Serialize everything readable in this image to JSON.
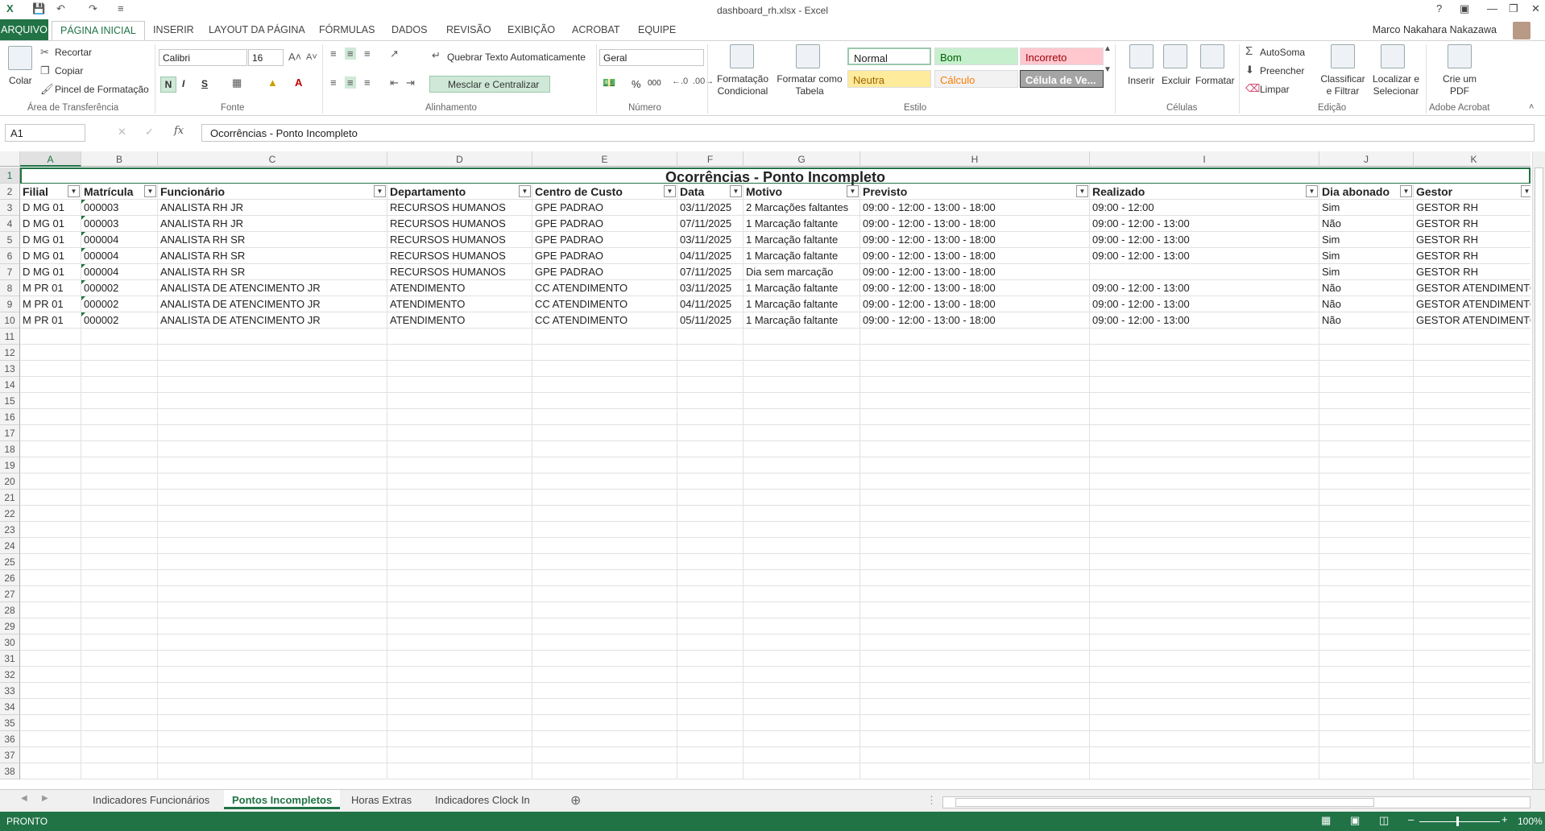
{
  "app": {
    "file_title": "dashboard_rh.xlsx - Excel",
    "user": "Marco Nakahara Nakazawa"
  },
  "tabs": [
    "ARQUIVO",
    "PÁGINA INICIAL",
    "INSERIR",
    "LAYOUT DA PÁGINA",
    "FÓRMULAS",
    "DADOS",
    "REVISÃO",
    "EXIBIÇÃO",
    "ACROBAT",
    "EQUIPE"
  ],
  "ribbon": {
    "clipboard": {
      "paste": "Colar",
      "cut": "Recortar",
      "copy": "Copiar",
      "format_painter": "Pincel de Formatação",
      "group": "Área de Transferência"
    },
    "font": {
      "name": "Calibri",
      "size": "16",
      "bold": "N",
      "italic": "I",
      "underline": "S",
      "group": "Fonte"
    },
    "alignment": {
      "wrap": "Quebrar Texto Automaticamente",
      "merge": "Mesclar e Centralizar",
      "group": "Alinhamento"
    },
    "number": {
      "format": "Geral",
      "percent": "%",
      "thousands": "000",
      "group": "Número"
    },
    "styles": {
      "cond_format": "Formatação Condicional",
      "format_table": "Formatar como Tabela",
      "cells": [
        {
          "label": "Normal",
          "bg": "#ffffff",
          "fg": "#222222"
        },
        {
          "label": "Bom",
          "bg": "#c6efce",
          "fg": "#006100"
        },
        {
          "label": "Incorreto",
          "bg": "#ffc7ce",
          "fg": "#9c0006"
        },
        {
          "label": "Neutra",
          "bg": "#ffeb9c",
          "fg": "#9c6500"
        },
        {
          "label": "Cálculo",
          "bg": "#f2f2f2",
          "fg": "#fa7d00"
        },
        {
          "label": "Célula de Ve...",
          "bg": "#a5a5a5",
          "fg": "#ffffff"
        }
      ],
      "group": "Estilo"
    },
    "cells": {
      "insert": "Inserir",
      "delete": "Excluir",
      "format": "Formatar",
      "group": "Células"
    },
    "editing": {
      "autosum": "AutoSoma",
      "fill": "Preencher",
      "clear": "Limpar",
      "sort": "Classificar e Filtrar",
      "find": "Localizar e Selecionar",
      "group": "Edição"
    },
    "acrobat": {
      "create_pdf": "Crie um PDF",
      "group": "Adobe Acrobat"
    }
  },
  "formula_bar": {
    "name_box": "A1",
    "fx": "fx",
    "content": "Ocorrências - Ponto Incompleto"
  },
  "sheet": {
    "columns": [
      "A",
      "B",
      "C",
      "D",
      "E",
      "F",
      "G",
      "H",
      "I",
      "J",
      "K"
    ],
    "title": "Ocorrências - Ponto Incompleto",
    "headers": [
      "Filial",
      "Matrícula",
      "Funcionário",
      "Departamento",
      "Centro de Custo",
      "Data",
      "Motivo",
      "Previsto",
      "Realizado",
      "Dia abonado",
      "Gestor"
    ],
    "rows": [
      [
        "D MG 01",
        "000003",
        "ANALISTA RH JR",
        "RECURSOS HUMANOS",
        "GPE PADRAO",
        "03/11/2025",
        "2 Marcações faltantes",
        "09:00 - 12:00 - 13:00 - 18:00",
        "09:00 - 12:00",
        "Sim",
        "GESTOR RH"
      ],
      [
        "D MG 01",
        "000003",
        "ANALISTA RH JR",
        "RECURSOS HUMANOS",
        "GPE PADRAO",
        "07/11/2025",
        "1 Marcação faltante",
        "09:00 - 12:00 - 13:00 - 18:00",
        "09:00 - 12:00 - 13:00",
        "Não",
        "GESTOR RH"
      ],
      [
        "D MG 01",
        "000004",
        "ANALISTA RH SR",
        "RECURSOS HUMANOS",
        "GPE PADRAO",
        "03/11/2025",
        "1 Marcação faltante",
        "09:00 - 12:00 - 13:00 - 18:00",
        "09:00 - 12:00 - 13:00",
        "Sim",
        "GESTOR RH"
      ],
      [
        "D MG 01",
        "000004",
        "ANALISTA RH SR",
        "RECURSOS HUMANOS",
        "GPE PADRAO",
        "04/11/2025",
        "1 Marcação faltante",
        "09:00 - 12:00 - 13:00 - 18:00",
        "09:00 - 12:00 - 13:00",
        "Sim",
        "GESTOR RH"
      ],
      [
        "D MG 01",
        "000004",
        "ANALISTA RH SR",
        "RECURSOS HUMANOS",
        "GPE PADRAO",
        "07/11/2025",
        "Dia sem marcação",
        "09:00 - 12:00 - 13:00 - 18:00",
        "",
        "Sim",
        "GESTOR RH"
      ],
      [
        "M PR 01",
        "000002",
        "ANALISTA DE ATENCIMENTO JR",
        "ATENDIMENTO",
        "CC ATENDIMENTO",
        "03/11/2025",
        "1 Marcação faltante",
        "09:00 - 12:00 - 13:00 - 18:00",
        "09:00 - 12:00 - 13:00",
        "Não",
        "GESTOR ATENDIMENTO"
      ],
      [
        "M PR 01",
        "000002",
        "ANALISTA DE ATENCIMENTO JR",
        "ATENDIMENTO",
        "CC ATENDIMENTO",
        "04/11/2025",
        "1 Marcação faltante",
        "09:00 - 12:00 - 13:00 - 18:00",
        "09:00 - 12:00 - 13:00",
        "Não",
        "GESTOR ATENDIMENTO"
      ],
      [
        "M PR 01",
        "000002",
        "ANALISTA DE ATENCIMENTO JR",
        "ATENDIMENTO",
        "CC ATENDIMENTO",
        "05/11/2025",
        "1 Marcação faltante",
        "09:00 - 12:00 - 13:00 - 18:00",
        "09:00 - 12:00 - 13:00",
        "Não",
        "GESTOR ATENDIMENTO"
      ]
    ],
    "visible_row_count": 38
  },
  "sheet_tabs": [
    "Indicadores Funcionários",
    "Pontos Incompletos",
    "Horas Extras",
    "Indicadores Clock In"
  ],
  "active_sheet_tab": "Pontos Incompletos",
  "status": {
    "mode": "PRONTO",
    "zoom": "100%"
  },
  "colors": {
    "accent": "#217346"
  }
}
